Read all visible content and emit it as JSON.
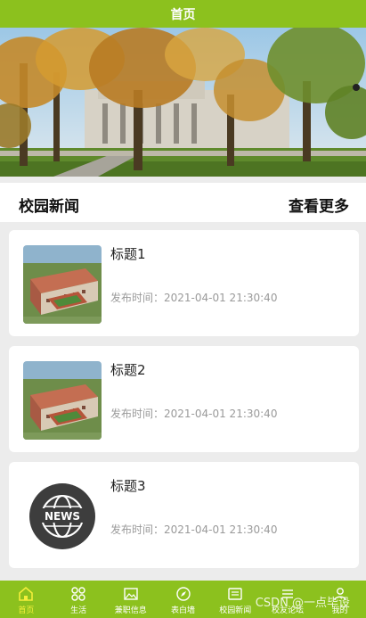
{
  "header": {
    "title": "首页"
  },
  "section": {
    "title": "校园新闻",
    "more_label": "查看更多"
  },
  "news": [
    {
      "title": "标题1",
      "time": "发布时间：2021-04-01 21:30:40"
    },
    {
      "title": "标题2",
      "time": "发布时间：2021-04-01 21:30:40"
    },
    {
      "title": "标题3",
      "time": "发布时间：2021-04-01 21:30:40",
      "icon_text": "NEWS"
    }
  ],
  "tabs": [
    {
      "label": "首页",
      "icon": "home-icon",
      "active": true
    },
    {
      "label": "生活",
      "icon": "grid-icon"
    },
    {
      "label": "兼职信息",
      "icon": "image-icon"
    },
    {
      "label": "表白墙",
      "icon": "compass-icon"
    },
    {
      "label": "校园新闻",
      "icon": "news-icon"
    },
    {
      "label": "校友论坛",
      "icon": "list-icon"
    },
    {
      "label": "我的",
      "icon": "user-icon"
    }
  ],
  "watermark": "CSDN @一点毕设",
  "colors": {
    "brand": "#8cc11e",
    "active_tab": "#f4ee3a"
  }
}
